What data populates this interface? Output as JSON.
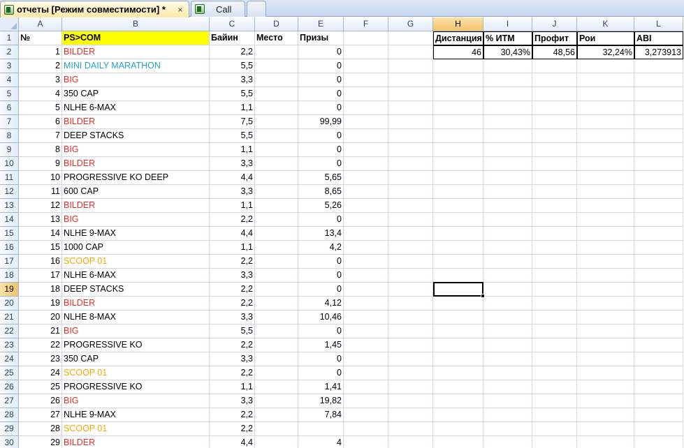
{
  "tabs": [
    {
      "label": "отчеты  [Режим совместимости] *",
      "active": true,
      "close": "×"
    },
    {
      "label": "Call",
      "active": false
    }
  ],
  "columns": [
    "A",
    "B",
    "C",
    "D",
    "E",
    "F",
    "G",
    "H",
    "I",
    "J",
    "K",
    "L"
  ],
  "selected_column": "H",
  "selected_row": 19,
  "header": {
    "A": "№",
    "B": "PS>COM",
    "C": "Байин",
    "D": "Место",
    "E": "Призы"
  },
  "rows": [
    {
      "n": "1",
      "name": "BILDER",
      "color": "#e0302a",
      "buyin": "2,2",
      "prize": "0"
    },
    {
      "n": "2",
      "name": "MINI DAILY MARATHON",
      "color": "#22a4c8",
      "buyin": "5,5",
      "prize": "0"
    },
    {
      "n": "3",
      "name": "BIG",
      "color": "#e0302a",
      "buyin": "3,3",
      "prize": "0"
    },
    {
      "n": "4",
      "name": "350 CAP",
      "color": "#000000",
      "buyin": "5,5",
      "prize": "0"
    },
    {
      "n": "5",
      "name": "NLHE 6-MAX",
      "color": "#000000",
      "buyin": "1,1",
      "prize": "0"
    },
    {
      "n": "6",
      "name": "BILDER",
      "color": "#e0302a",
      "buyin": "7,5",
      "prize": "99,99"
    },
    {
      "n": "7",
      "name": "DEEP STACKS",
      "color": "#000000",
      "buyin": "5,5",
      "prize": "0"
    },
    {
      "n": "8",
      "name": "BIG",
      "color": "#e0302a",
      "buyin": "1,1",
      "prize": "0"
    },
    {
      "n": "9",
      "name": "BILDER",
      "color": "#e0302a",
      "buyin": "3,3",
      "prize": "0"
    },
    {
      "n": "10",
      "name": "PROGRESSIVE KO DEEP",
      "color": "#000000",
      "buyin": "4,4",
      "prize": "5,65"
    },
    {
      "n": "11",
      "name": "600 CAP",
      "color": "#000000",
      "buyin": "3,3",
      "prize": "8,65"
    },
    {
      "n": "12",
      "name": "BILDER",
      "color": "#e0302a",
      "buyin": "1,1",
      "prize": "5,26"
    },
    {
      "n": "13",
      "name": "BIG",
      "color": "#e0302a",
      "buyin": "2,2",
      "prize": "0"
    },
    {
      "n": "14",
      "name": "NLHE 9-MAX",
      "color": "#000000",
      "buyin": "4,4",
      "prize": "13,4"
    },
    {
      "n": "15",
      "name": "1000 CAP",
      "color": "#000000",
      "buyin": "1,1",
      "prize": "4,2"
    },
    {
      "n": "16",
      "name": "SCOOP 01",
      "color": "#f0a800",
      "buyin": "2,2",
      "prize": "0"
    },
    {
      "n": "17",
      "name": "NLHE 6-MAX",
      "color": "#000000",
      "buyin": "3,3",
      "prize": "0"
    },
    {
      "n": "18",
      "name": "DEEP STACKS",
      "color": "#000000",
      "buyin": "2,2",
      "prize": "0"
    },
    {
      "n": "19",
      "name": "BILDER",
      "color": "#e0302a",
      "buyin": "2,2",
      "prize": "4,12"
    },
    {
      "n": "20",
      "name": "NLHE 8-MAX",
      "color": "#000000",
      "buyin": "3,3",
      "prize": "10,46"
    },
    {
      "n": "21",
      "name": "BIG",
      "color": "#e0302a",
      "buyin": "5,5",
      "prize": "0"
    },
    {
      "n": "22",
      "name": "PROGRESSIVE KO",
      "color": "#000000",
      "buyin": "2,2",
      "prize": "1,45"
    },
    {
      "n": "23",
      "name": "350 CAP",
      "color": "#000000",
      "buyin": "3,3",
      "prize": "0"
    },
    {
      "n": "24",
      "name": "SCOOP 01",
      "color": "#f0a800",
      "buyin": "2,2",
      "prize": "0"
    },
    {
      "n": "25",
      "name": "PROGRESSIVE KO",
      "color": "#000000",
      "buyin": "1,1",
      "prize": "1,41"
    },
    {
      "n": "26",
      "name": "BIG",
      "color": "#e0302a",
      "buyin": "3,3",
      "prize": "19,82"
    },
    {
      "n": "27",
      "name": "NLHE 9-MAX",
      "color": "#000000",
      "buyin": "2,2",
      "prize": "7,84"
    },
    {
      "n": "28",
      "name": "SCOOP 01",
      "color": "#f0a800",
      "buyin": "2,2",
      "prize": ""
    },
    {
      "n": "29",
      "name": "BILDER",
      "color": "#e0302a",
      "buyin": "4,4",
      "prize": "4"
    }
  ],
  "stats": {
    "headers": {
      "H": "Дистанция",
      "I": "% ИТМ",
      "J": "Профит",
      "K": "Рои",
      "L": "ABI"
    },
    "values": {
      "H": "46",
      "I": "30,43%",
      "J": "48,56",
      "K": "32,24%",
      "L": "3,273913"
    }
  },
  "colors": {
    "header_fill": "#ffff00",
    "tab_active": "#ffe9a8",
    "grid_line": "#d0d7e5"
  }
}
